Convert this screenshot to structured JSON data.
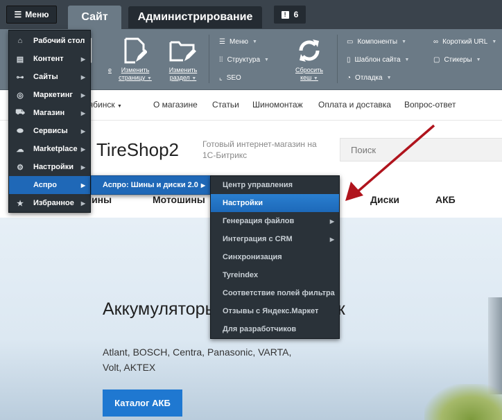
{
  "topbar": {
    "menu_label": "Меню",
    "tab_site": "Сайт",
    "tab_admin": "Администрирование",
    "notifications_count": "6"
  },
  "toolbar": {
    "big_buttons": [
      {
        "label": "Изменить\nстраницу"
      },
      {
        "label": "Изменить\nраздел"
      },
      {
        "label": "Сбросить\nкеш"
      }
    ],
    "hidden_label_fragment": "е",
    "group1": [
      "Меню",
      "Структура",
      "SEO"
    ],
    "group2": [
      "Компоненты",
      "Шаблон сайта",
      "Отладка"
    ],
    "group3": [
      "Короткий URL",
      "Стикеры"
    ]
  },
  "main_menu": {
    "items": [
      {
        "label": "Рабочий стол",
        "icon": "home-icon"
      },
      {
        "label": "Контент",
        "icon": "document-icon"
      },
      {
        "label": "Сайты",
        "icon": "sitemap-icon"
      },
      {
        "label": "Маркетинг",
        "icon": "target-icon"
      },
      {
        "label": "Магазин",
        "icon": "cart-icon"
      },
      {
        "label": "Сервисы",
        "icon": "services-icon"
      },
      {
        "label": "Marketplace",
        "icon": "cloud-icon"
      },
      {
        "label": "Настройки",
        "icon": "gear-icon"
      },
      {
        "label": "Аспро",
        "icon": ""
      },
      {
        "label": "Избранное",
        "icon": "star-icon"
      }
    ]
  },
  "submenu1": {
    "label": "Аспро: Шины и диски 2.0"
  },
  "submenu2": {
    "items": [
      {
        "label": "Центр управления"
      },
      {
        "label": "Настройки"
      },
      {
        "label": "Генерация файлов"
      },
      {
        "label": "Интеграция с CRM"
      },
      {
        "label": "Синхронизация"
      },
      {
        "label": "Tyreindex"
      },
      {
        "label": "Соответствие полей фильтра"
      },
      {
        "label": "Отзывы с Яндекс.Маркет"
      },
      {
        "label": "Для разработчиков"
      }
    ]
  },
  "site": {
    "city": "Челябинск",
    "nav": [
      "О магазине",
      "Статьи",
      "Шиномонтаж",
      "Оплата и доставка",
      "Вопрос-ответ"
    ],
    "logo": "TireShop2",
    "tagline": "Готовый интернет-магазин на 1С-Битрикс",
    "search_placeholder": "Поиск",
    "categories": [
      "Шины",
      "Мотошины",
      "Диски",
      "АКБ"
    ],
    "hero_title": "Аккумуляторы ведущих марок",
    "hero_sub": "Atlant, BOSCH, Centra, Panasonic, VARTA, Volt, AKTEX",
    "hero_button": "Каталог АКБ"
  },
  "colors": {
    "accent": "#1f68b7",
    "annotation_arrow": "#b0141d"
  }
}
